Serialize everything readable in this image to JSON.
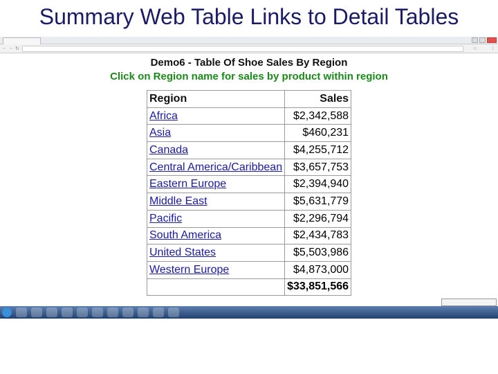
{
  "slide_title": "Summary Web Table Links to Detail Tables",
  "page": {
    "title": "Demo6 - Table Of Shoe Sales By Region",
    "subtitle": "Click on Region name for sales by product within region"
  },
  "table": {
    "headers": {
      "region": "Region",
      "sales": "Sales"
    },
    "rows": [
      {
        "region": "Africa",
        "sales": "$2,342,588"
      },
      {
        "region": "Asia",
        "sales": "$460,231"
      },
      {
        "region": "Canada",
        "sales": "$4,255,712"
      },
      {
        "region": "Central America/Caribbean",
        "sales": "$3,657,753"
      },
      {
        "region": "Eastern Europe",
        "sales": "$2,394,940"
      },
      {
        "region": "Middle East",
        "sales": "$5,631,779"
      },
      {
        "region": "Pacific",
        "sales": "$2,296,794"
      },
      {
        "region": "South America",
        "sales": "$2,434,783"
      },
      {
        "region": "United States",
        "sales": "$5,503,986"
      },
      {
        "region": "Western Europe",
        "sales": "$4,873,000"
      }
    ],
    "total": "$33,851,566"
  },
  "colors": {
    "link": "#1a1aa6",
    "subtitle": "#1a8a1a",
    "slide_title": "#1a1a66"
  }
}
